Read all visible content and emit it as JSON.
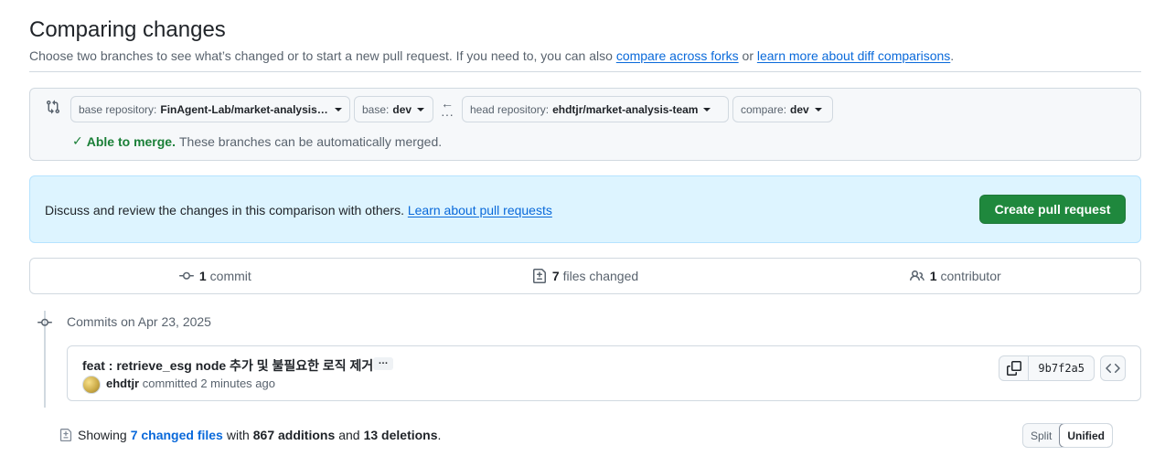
{
  "header": {
    "title": "Comparing changes",
    "subtitle_prefix": "Choose two branches to see what’s changed or to start a new pull request. If you need to, you can also",
    "link_forks": "compare across forks",
    "or": "or",
    "link_learn": "learn more about diff comparisons",
    "period": "."
  },
  "range": {
    "base_repo_label": "base repository:",
    "base_repo_value": "FinAgent-Lab/market-analysis-team",
    "base_label": "base:",
    "base_value": "dev",
    "head_repo_label": "head repository:",
    "head_repo_value": "ehdtjr/market-analysis-team",
    "compare_label": "compare:",
    "compare_value": "dev",
    "merge_status": "Able to merge.",
    "merge_detail": "These branches can be automatically merged."
  },
  "banner": {
    "text": "Discuss and review the changes in this comparison with others.",
    "link": "Learn about pull requests",
    "button": "Create pull request"
  },
  "stats": {
    "commits_count": "1",
    "commits_label": "commit",
    "files_count": "7",
    "files_label": "files changed",
    "contributors_count": "1",
    "contributors_label": "contributor"
  },
  "commits": {
    "date_heading": "Commits on Apr 23, 2025",
    "items": [
      {
        "message": "feat : retrieve_esg node 추가 및 불필요한 로직 제거",
        "more": "…",
        "author": "ehdtjr",
        "action": "committed 2 minutes ago",
        "sha": "9b7f2a5"
      }
    ]
  },
  "diff_summary": {
    "showing": "Showing",
    "changed_files": "7 changed files",
    "with": "with",
    "additions": "867 additions",
    "and": "and",
    "deletions": "13 deletions",
    "period": "."
  },
  "view_toggle": {
    "split": "Split",
    "unified": "Unified"
  }
}
